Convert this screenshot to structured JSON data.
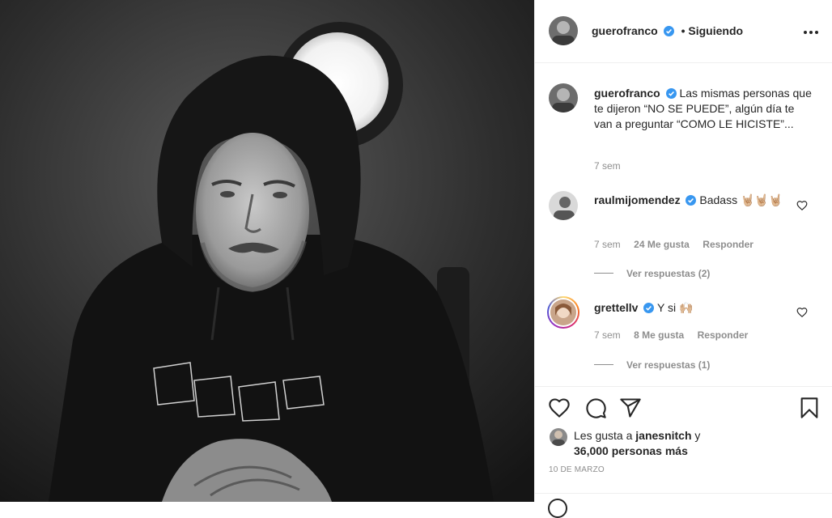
{
  "post": {
    "author": "guerofranco",
    "follow_status": "• Siguiendo",
    "caption": "Las mismas personas que te dijeron “NO SE PUEDE”, algún día te van a preguntar “COMO LE HICISTE”...",
    "caption_time": "7 sem",
    "likes_prefix": "Les gusta a",
    "likes_user": "janesnitch",
    "likes_suffix": "y",
    "likes_others": "36,000 personas más",
    "date": "10 DE MARZO"
  },
  "comments": [
    {
      "user": "raulmijomendez",
      "text": "Badass 🤘🏼🤘🏼🤘🏼",
      "time": "7 sem",
      "likes": "24 Me gusta",
      "reply": "Responder",
      "view_replies": "Ver respuestas (2)"
    },
    {
      "user": "grettellv",
      "text": "Y si 🙌🏼",
      "time": "7 sem",
      "likes": "8 Me gusta",
      "reply": "Responder",
      "view_replies": "Ver respuestas (1)"
    }
  ],
  "icons": {
    "more": "more-options-icon",
    "like": "heart-icon",
    "comment": "comment-icon",
    "share": "share-icon",
    "save": "bookmark-icon",
    "verified": "verified-badge-icon"
  },
  "colors": {
    "verified": "#3897f0",
    "link": "#262626",
    "muted": "#8e8e8e"
  }
}
